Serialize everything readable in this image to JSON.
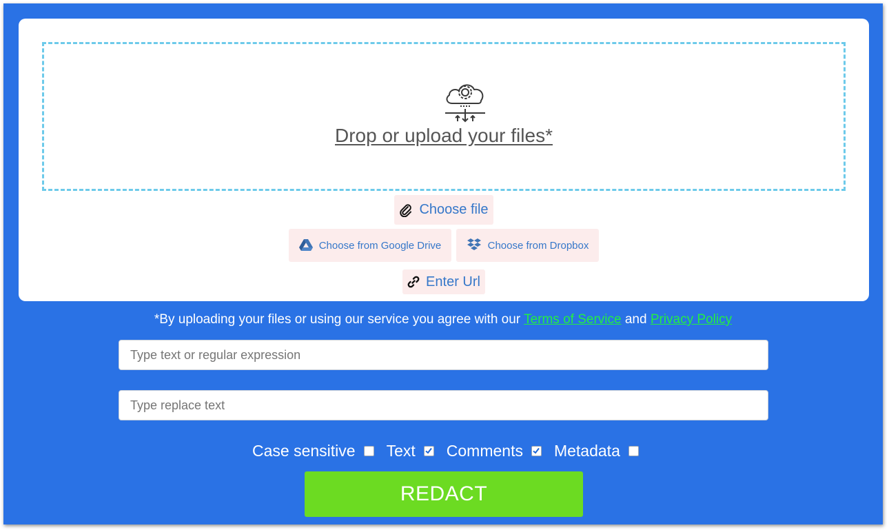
{
  "upload": {
    "drop_text": "Drop or upload your files*",
    "choose_file_label": "Choose file",
    "google_drive_label": "Choose from Google Drive",
    "dropbox_label": "Choose from Dropbox",
    "enter_url_label": "Enter Url"
  },
  "agreement": {
    "prefix": "*By uploading your files or using our service you agree with our ",
    "terms_link": "Terms of Service",
    "conjunction": " and ",
    "privacy_link": "Privacy Policy"
  },
  "search": {
    "placeholder": "Type text or regular expression",
    "value": ""
  },
  "replace": {
    "placeholder": "Type replace text",
    "value": ""
  },
  "options": [
    {
      "label": "Case sensitive",
      "checked": false
    },
    {
      "label": "Text",
      "checked": true
    },
    {
      "label": "Comments",
      "checked": true
    },
    {
      "label": "Metadata",
      "checked": false
    }
  ],
  "action": {
    "redact_label": "REDACT"
  },
  "colors": {
    "background": "#2a72e5",
    "dropzone_border": "#6dcaea",
    "link_accent": "#22ee44",
    "action_button": "#6cdb22",
    "pill_background": "#fcecec",
    "pill_text": "#3577c9"
  },
  "icons": {
    "upload": "cloud-gear-upload-icon",
    "choose_file": "paperclip-icon",
    "google_drive": "google-drive-icon",
    "dropbox": "dropbox-icon",
    "enter_url": "link-icon",
    "checkmark": "checkmark-icon"
  }
}
